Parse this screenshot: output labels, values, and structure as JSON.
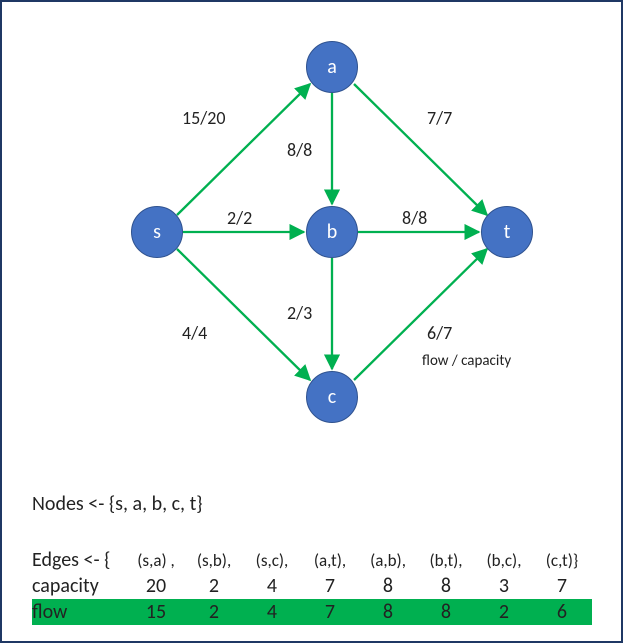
{
  "nodes": {
    "s": "s",
    "a": "a",
    "b": "b",
    "c": "c",
    "t": "t"
  },
  "edge_labels": {
    "sa": "15/20",
    "sb": "2/2",
    "sc": "4/4",
    "ab": "8/8",
    "at": "7/7",
    "bt": "8/8",
    "bc": "2/3",
    "ct": "6/7"
  },
  "legend": "flow / capacity",
  "nodes_line": "Nodes <- {s, a, b, c, t}",
  "edges_line_label": "Edges <- {",
  "edges_list": [
    "(s,a) ,",
    "(s,b),",
    "(s,c),",
    "(a,t),",
    "(a,b),",
    "(b,t),",
    "(b,c),",
    "(c,t)}"
  ],
  "cap_label": "capacity",
  "flow_label": "flow",
  "capacity": [
    "20",
    "2",
    "4",
    "7",
    "8",
    "8",
    "3",
    "7"
  ],
  "flow": [
    "15",
    "2",
    "4",
    "7",
    "8",
    "8",
    "2",
    "6"
  ],
  "chart_data": {
    "type": "diagram",
    "description": "Flow network with source s, sink t, intermediate nodes a, b, c. Edge labels show flow/capacity.",
    "nodes": [
      "s",
      "a",
      "b",
      "c",
      "t"
    ],
    "edges": [
      {
        "from": "s",
        "to": "a",
        "flow": 15,
        "capacity": 20
      },
      {
        "from": "s",
        "to": "b",
        "flow": 2,
        "capacity": 2
      },
      {
        "from": "s",
        "to": "c",
        "flow": 4,
        "capacity": 4
      },
      {
        "from": "a",
        "to": "t",
        "flow": 7,
        "capacity": 7
      },
      {
        "from": "a",
        "to": "b",
        "flow": 8,
        "capacity": 8
      },
      {
        "from": "b",
        "to": "t",
        "flow": 8,
        "capacity": 8
      },
      {
        "from": "b",
        "to": "c",
        "flow": 2,
        "capacity": 3
      },
      {
        "from": "c",
        "to": "t",
        "flow": 6,
        "capacity": 7
      }
    ]
  }
}
